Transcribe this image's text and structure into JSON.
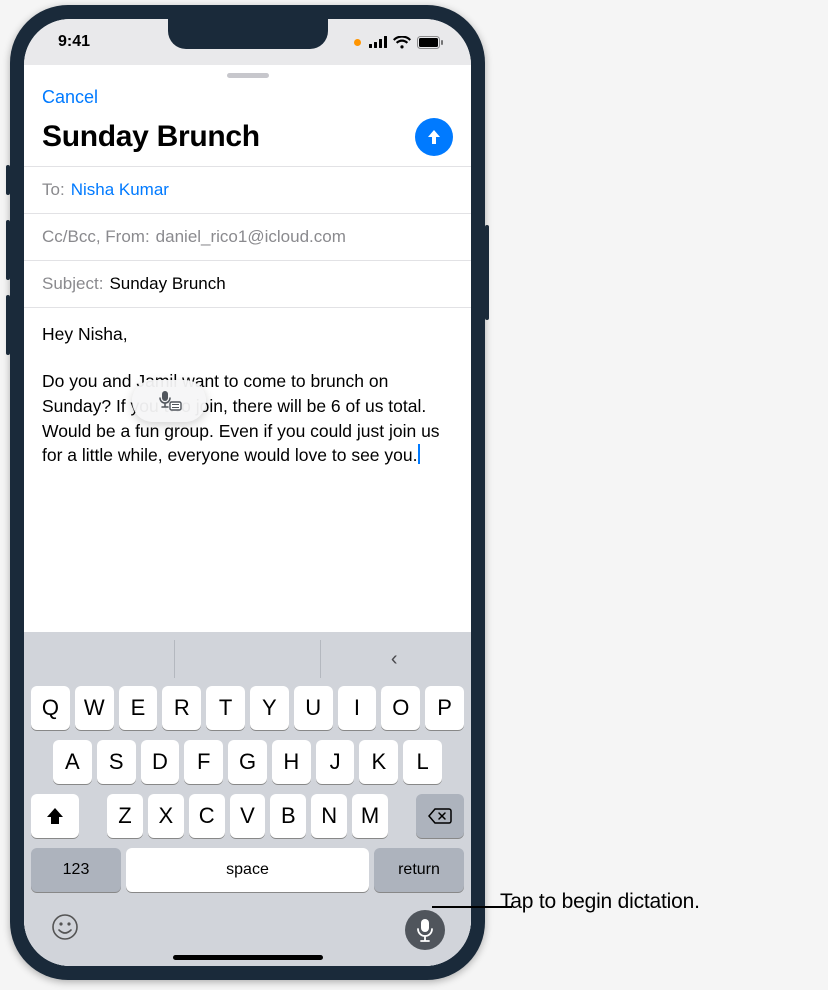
{
  "status": {
    "time": "9:41"
  },
  "sheet": {
    "cancel": "Cancel",
    "title": "Sunday Brunch",
    "to_label": "To:",
    "to_value": "Nisha Kumar",
    "cc_label": "Cc/Bcc, From:",
    "cc_value": "daniel_rico1@icloud.com",
    "subject_label": "Subject:",
    "subject_value": "Sunday Brunch",
    "body_greeting": "Hey Nisha,",
    "body_main": "Do you and Jamil want to come to brunch on Sunday? If you two join, there will be 6 of us total. Would be a fun group. Even if you could just join us for a little while, everyone would love to see you."
  },
  "keyboard": {
    "row1": [
      "Q",
      "W",
      "E",
      "R",
      "T",
      "Y",
      "U",
      "I",
      "O",
      "P"
    ],
    "row2": [
      "A",
      "S",
      "D",
      "F",
      "G",
      "H",
      "J",
      "K",
      "L"
    ],
    "row3": [
      "Z",
      "X",
      "C",
      "V",
      "B",
      "N",
      "M"
    ],
    "num": "123",
    "space": "space",
    "return": "return",
    "pred_chevron": "‹"
  },
  "callout": "Tap to begin dictation."
}
